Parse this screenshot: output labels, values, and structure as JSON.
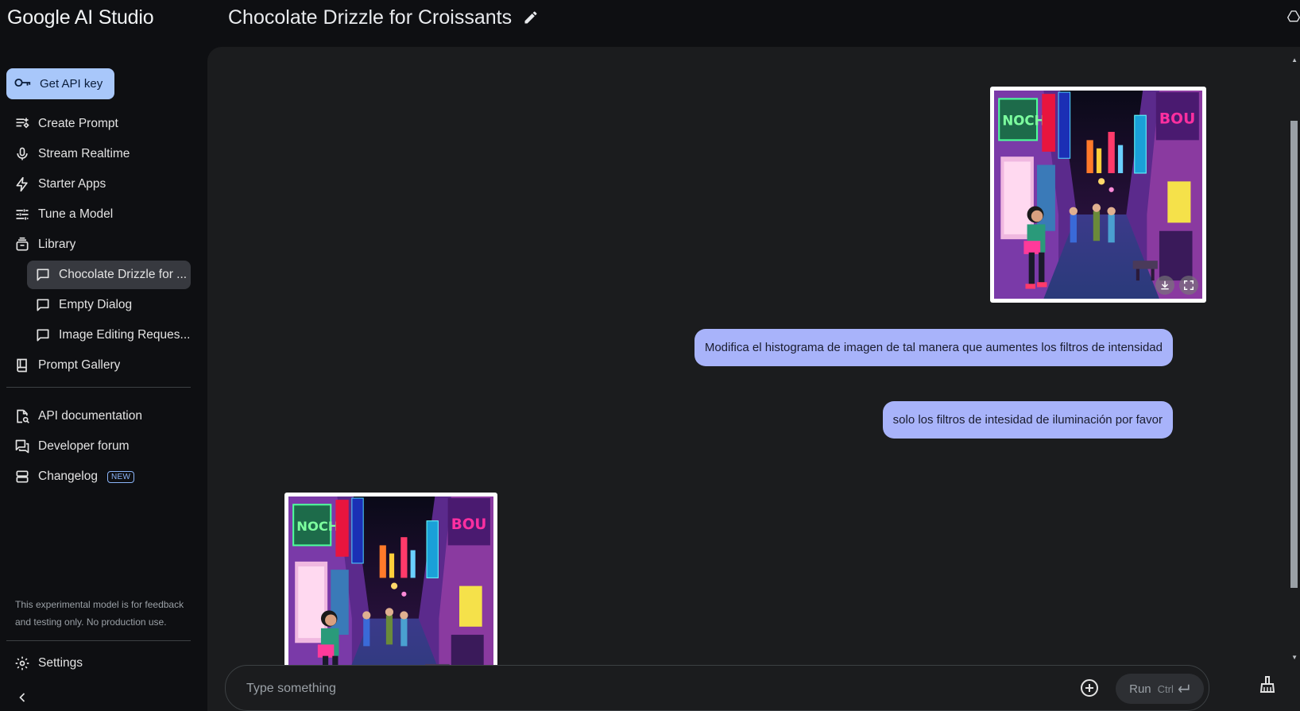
{
  "app": {
    "brand": "Google AI Studio"
  },
  "header": {
    "title": "Chocolate Drizzle for Croissants"
  },
  "sidebar": {
    "api_key_label": "Get API key",
    "nav": [
      {
        "label": "Create Prompt",
        "icon": "create-prompt-icon"
      },
      {
        "label": "Stream Realtime",
        "icon": "microphone-icon"
      },
      {
        "label": "Starter Apps",
        "icon": "bolt-icon"
      },
      {
        "label": "Tune a Model",
        "icon": "tune-icon"
      },
      {
        "label": "Library",
        "icon": "library-icon"
      }
    ],
    "library_items": [
      {
        "label": "Chocolate Drizzle for ...",
        "active": true
      },
      {
        "label": "Empty Dialog",
        "active": false
      },
      {
        "label": "Image Editing Reques...",
        "active": false
      }
    ],
    "prompt_gallery": "Prompt Gallery",
    "links": [
      {
        "label": "API documentation",
        "icon": "api-docs-icon"
      },
      {
        "label": "Developer forum",
        "icon": "forum-icon"
      },
      {
        "label": "Changelog",
        "icon": "changelog-icon",
        "badge": "NEW"
      }
    ],
    "disclaimer": "This experimental model is for feedback and testing only. No production use.",
    "settings_label": "Settings"
  },
  "chat": {
    "messages": [
      {
        "role": "user",
        "type": "image"
      },
      {
        "role": "user",
        "type": "text",
        "text": "Modifica el histograma de imagen de tal manera que aumentes los filtros de intensidad"
      },
      {
        "role": "user",
        "type": "text",
        "text": "solo los filtros de intesidad de iluminación por favor"
      },
      {
        "role": "model",
        "type": "image"
      }
    ]
  },
  "composer": {
    "placeholder": "Type something",
    "run_label": "Run",
    "shortcut": "Ctrl"
  },
  "colors": {
    "accent": "#a8c7fa",
    "bubble": "#a8b3fa",
    "panel": "#1b1c1e",
    "background": "#0e0f12"
  }
}
